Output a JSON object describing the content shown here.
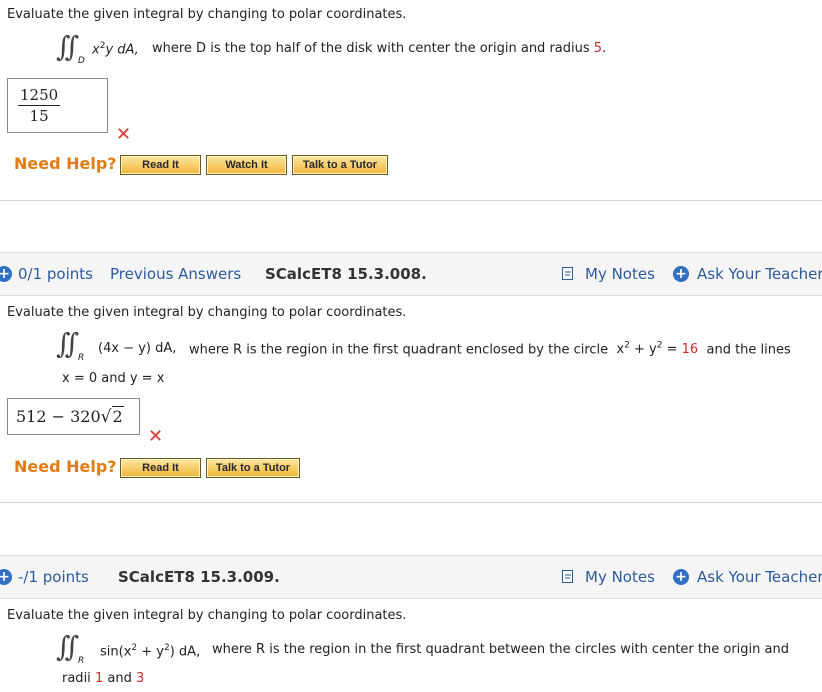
{
  "q1": {
    "prompt": "Evaluate the given integral by changing to polar coordinates.",
    "integrand_pre": "x",
    "integrand_exp": "2",
    "integrand_post": "y dA,",
    "region_sub": "D",
    "desc_pre": "where D is the top half of the disk with center the origin and radius",
    "radius": "5",
    "desc_end": ".",
    "answer_num": "1250",
    "answer_den": "15",
    "help_label": "Need Help?",
    "buttons": [
      "Read It",
      "Watch It",
      "Talk to a Tutor"
    ]
  },
  "q2": {
    "points": "0/1 points",
    "prev_answers": "Previous Answers",
    "code": "SCalcET8 15.3.008.",
    "my_notes": "My Notes",
    "ask_teacher": "Ask Your Teacher",
    "prompt": "Evaluate the given integral by changing to polar coordinates.",
    "integrand": "(4x − y) dA,",
    "region_sub": "R",
    "desc_pre": "where R is the region in the first quadrant enclosed by the circle",
    "circle_a": "x",
    "circle_b": "+ y",
    "circle_eq": "=",
    "circle_val": "16",
    "desc_post": "and the lines",
    "lines": "x = 0  and  y = x",
    "answer_pre": "512 − 320",
    "answer_rad": "2",
    "help_label": "Need Help?",
    "buttons": [
      "Read It",
      "Talk to a Tutor"
    ]
  },
  "q3": {
    "points": "-/1 points",
    "code": "SCalcET8 15.3.009.",
    "my_notes": "My Notes",
    "ask_teacher": "Ask Your Teacher",
    "prompt": "Evaluate the given integral by changing to polar coordinates.",
    "integrand_a": "sin(x",
    "integrand_b": "+ y",
    "integrand_c": ") dA,",
    "region_sub": "R",
    "desc_pre": "where R is the region in the first quadrant between the circles with center the origin and",
    "radii_label": "radii",
    "r1": "1",
    "and_word": "and",
    "r2": "3"
  }
}
